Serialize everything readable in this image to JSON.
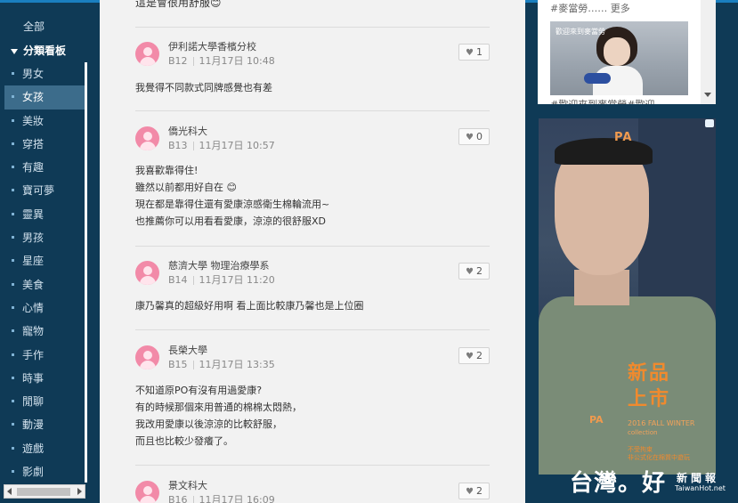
{
  "sidebar": {
    "all_label": "全部",
    "section_label": "分類看板",
    "items": [
      {
        "label": "男女"
      },
      {
        "label": "女孩"
      },
      {
        "label": "美妝"
      },
      {
        "label": "穿搭"
      },
      {
        "label": "有趣"
      },
      {
        "label": "寶可夢"
      },
      {
        "label": "靈異"
      },
      {
        "label": "男孩"
      },
      {
        "label": "星座"
      },
      {
        "label": "美食"
      },
      {
        "label": "心情"
      },
      {
        "label": "寵物"
      },
      {
        "label": "手作"
      },
      {
        "label": "時事"
      },
      {
        "label": "閒聊"
      },
      {
        "label": "動漫"
      },
      {
        "label": "遊戲"
      },
      {
        "label": "影劇"
      }
    ],
    "active_index": 1
  },
  "feed": {
    "top_text": "這是會很用舒服😊",
    "posts": [
      {
        "author": "伊利諾大學香檳分校",
        "floor": "B12",
        "time": "11月17日 10:48",
        "likes": "1",
        "lines": [
          "我覺得不同款式同牌感覺也有差"
        ]
      },
      {
        "author": "僑光科大",
        "floor": "B13",
        "time": "11月17日 10:57",
        "likes": "0",
        "lines": [
          "我喜歡靠得住!",
          "雖然以前都用好自在 😊",
          "現在都是靠得住還有愛康涼感衛生棉輪流用~",
          "也推薦你可以用看看愛康，涼涼的很舒服XD"
        ]
      },
      {
        "author": "慈濟大學 物理治療學系",
        "floor": "B14",
        "time": "11月17日 11:20",
        "likes": "2",
        "lines": [
          "康乃馨真的超級好用啊 看上面比較康乃馨也是上位圈"
        ]
      },
      {
        "author": "長榮大學",
        "floor": "B15",
        "time": "11月17日 13:35",
        "likes": "2",
        "lines": [
          "不知道原PO有沒有用過愛康?",
          "有的時候那個來用普通的棉棉太悶熱，",
          "我改用愛康以後涼涼的比較舒服，",
          "而且也比較少發癢了。"
        ]
      },
      {
        "author": "景文科大",
        "floor": "B16",
        "time": "11月17日 16:09",
        "likes": "2",
        "lines": []
      }
    ]
  },
  "ad_top": {
    "tag_text": "#麥當勞……  更多",
    "logo_text": "歡迎來到麥當勞",
    "cut_text": "#歡迎來到麥當勞#歡迎"
  },
  "ad_big": {
    "brand": "PA",
    "title_line1": "新品",
    "title_line2": "上市",
    "brand_small": "PA",
    "season": "2016 FALL WINTER",
    "collection": "collection",
    "fine1": "不受拘束",
    "fine2": "非公式化在棉質中遊玩"
  },
  "watermark": {
    "big": "台灣。好",
    "small": "新聞報",
    "url": "TaiwanHot.net"
  },
  "colors": {
    "page_bg": "#0f3a56",
    "feed_bg": "#f2f2f2",
    "avatar_pink": "#f28aa8",
    "ad_orange": "#f08a2e"
  }
}
